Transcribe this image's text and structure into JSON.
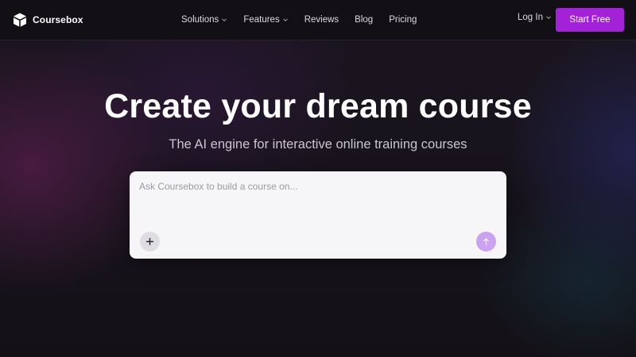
{
  "brand": {
    "name": "Coursebox",
    "logo_icon": "cube-icon"
  },
  "nav": {
    "items": [
      {
        "label": "Solutions",
        "has_dropdown": true
      },
      {
        "label": "Features",
        "has_dropdown": true
      },
      {
        "label": "Reviews",
        "has_dropdown": false
      },
      {
        "label": "Blog",
        "has_dropdown": false
      },
      {
        "label": "Pricing",
        "has_dropdown": false
      }
    ],
    "login_label": "Log In",
    "cta_label": "Start Free"
  },
  "hero": {
    "title": "Create your dream course",
    "subtitle": "The AI engine for interactive online training courses"
  },
  "prompt": {
    "placeholder": "Ask Coursebox to build a course on...",
    "value": "",
    "add_icon": "plus-icon",
    "send_icon": "arrow-up-icon"
  },
  "colors": {
    "accent": "#a322d8",
    "send_button": "#c9a3f0",
    "background": "#141218"
  }
}
